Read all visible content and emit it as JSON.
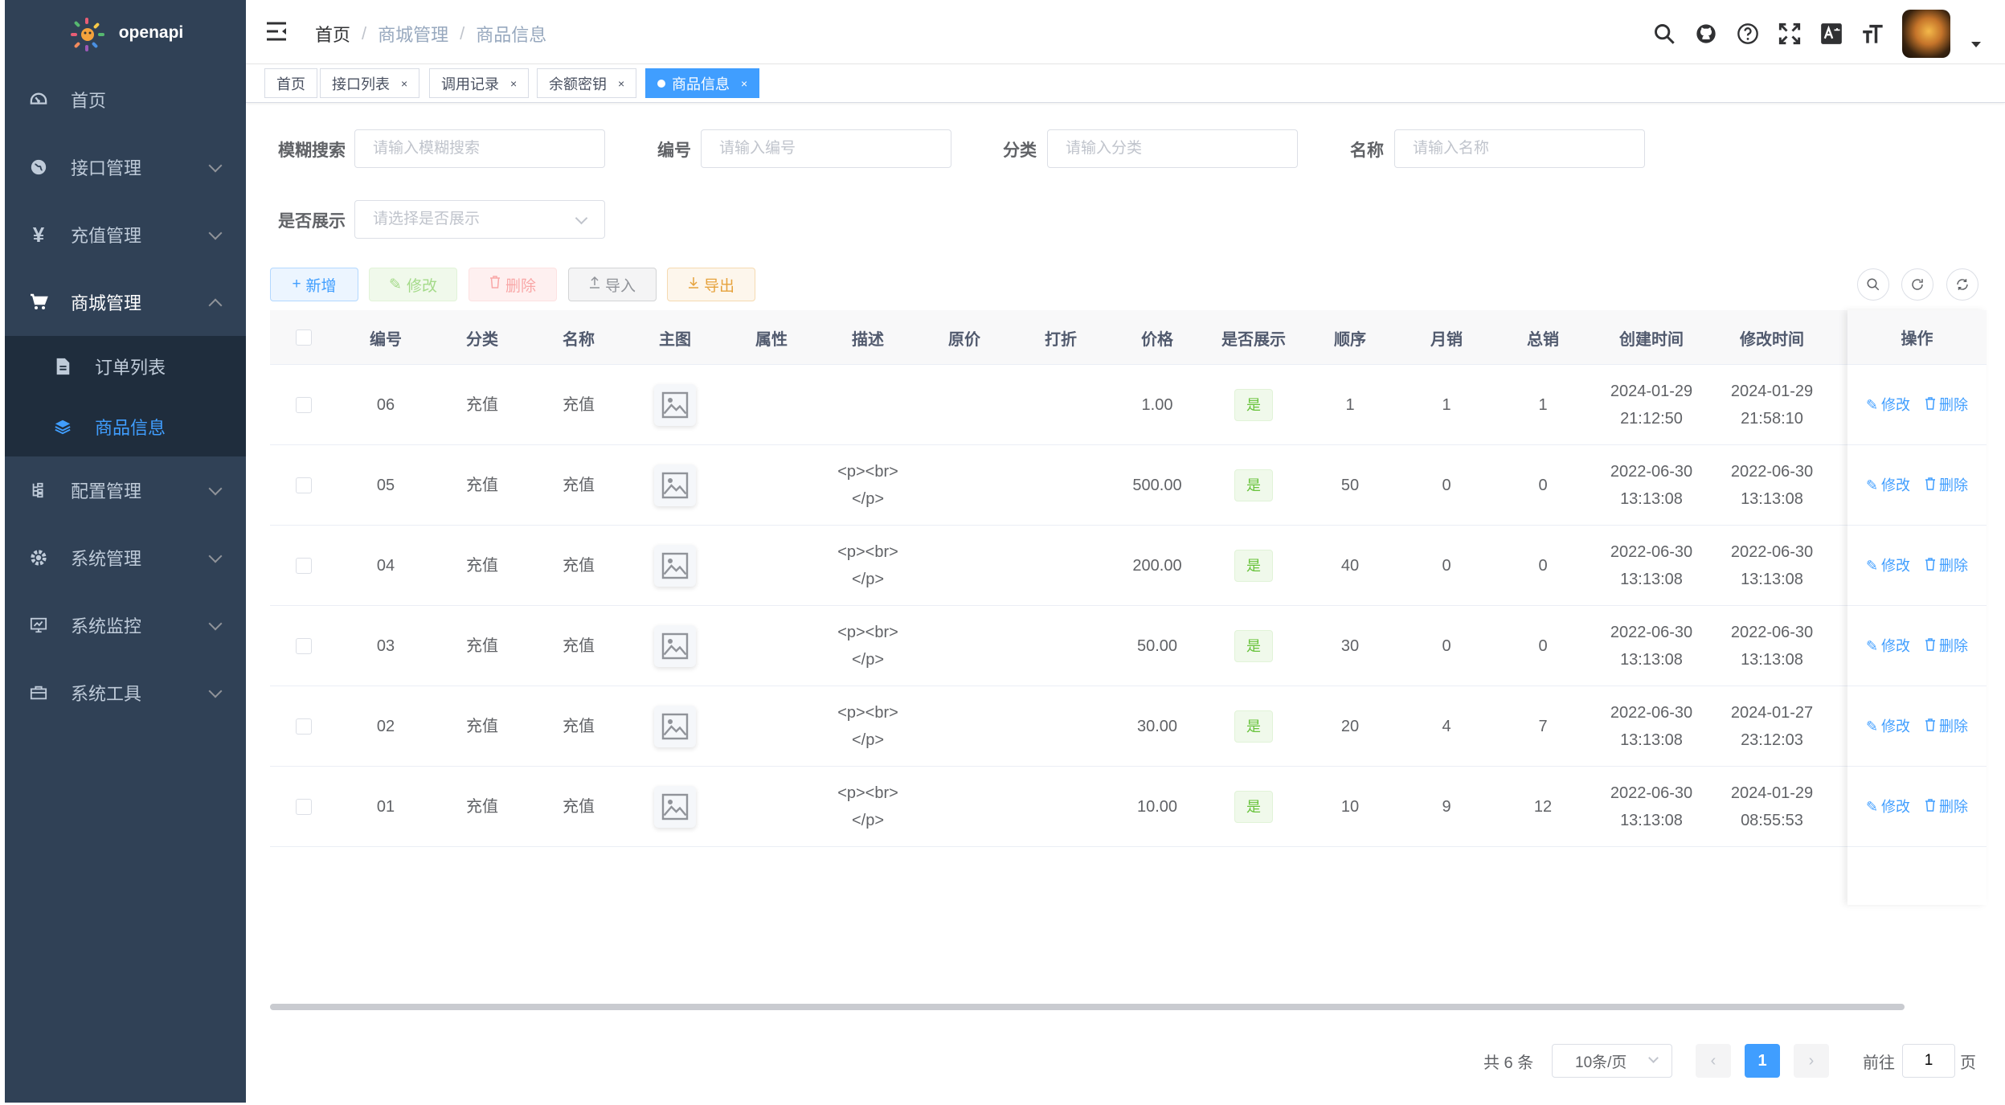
{
  "app": {
    "name": "openapi"
  },
  "sidebar": {
    "items": [
      {
        "label": "首页",
        "icon": "dashboard-icon"
      },
      {
        "label": "接口管理",
        "icon": "globe-icon"
      },
      {
        "label": "充值管理",
        "icon": "yen-icon"
      },
      {
        "label": "商城管理",
        "icon": "cart-icon"
      },
      {
        "label": "配置管理",
        "icon": "tree-icon"
      },
      {
        "label": "系统管理",
        "icon": "gear-icon"
      },
      {
        "label": "系统监控",
        "icon": "monitor-icon"
      },
      {
        "label": "系统工具",
        "icon": "toolbox-icon"
      }
    ],
    "submenu": [
      {
        "label": "订单列表",
        "icon": "document-icon"
      },
      {
        "label": "商品信息",
        "icon": "layers-icon"
      }
    ]
  },
  "header": {
    "breadcrumb": [
      "首页",
      "商城管理",
      "商品信息"
    ],
    "icons": [
      "search-icon",
      "github-icon",
      "help-icon",
      "fullscreen-icon",
      "translate-icon",
      "font-size-icon"
    ]
  },
  "tags": [
    {
      "label": "首页"
    },
    {
      "label": "接口列表"
    },
    {
      "label": "调用记录"
    },
    {
      "label": "余额密钥"
    },
    {
      "label": "商品信息"
    }
  ],
  "search": {
    "fuzzy_label": "模糊搜索",
    "fuzzy_placeholder": "请输入模糊搜索",
    "code_label": "编号",
    "code_placeholder": "请输入编号",
    "category_label": "分类",
    "category_placeholder": "请输入分类",
    "name_label": "名称",
    "name_placeholder": "请输入名称",
    "show_label": "是否展示",
    "show_placeholder": "请选择是否展示"
  },
  "toolbar": {
    "add": "新增",
    "edit": "修改",
    "delete": "删除",
    "import": "导入",
    "export": "导出"
  },
  "table": {
    "columns": [
      "编号",
      "分类",
      "名称",
      "主图",
      "属性",
      "描述",
      "原价",
      "打折",
      "价格",
      "是否展示",
      "顺序",
      "月销",
      "总销",
      "创建时间",
      "修改时间",
      "操作"
    ],
    "rows": [
      {
        "code": "06",
        "category": "充值",
        "name": "充值",
        "attr": "",
        "desc1": "",
        "desc2": "",
        "orig": "",
        "discount": "",
        "price": "1.00",
        "show": "是",
        "order": "1",
        "monthly": "1",
        "total": "1",
        "created_date": "2024-01-29",
        "created_time": "21:12:50",
        "modified_date": "2024-01-29",
        "modified_time": "21:58:10",
        "edit": "修改",
        "delete": "删除"
      },
      {
        "code": "05",
        "category": "充值",
        "name": "充值",
        "attr": "",
        "desc1": "<p><br>",
        "desc2": "</p>",
        "orig": "",
        "discount": "",
        "price": "500.00",
        "show": "是",
        "order": "50",
        "monthly": "0",
        "total": "0",
        "created_date": "2022-06-30",
        "created_time": "13:13:08",
        "modified_date": "2022-06-30",
        "modified_time": "13:13:08",
        "edit": "修改",
        "delete": "删除"
      },
      {
        "code": "04",
        "category": "充值",
        "name": "充值",
        "attr": "",
        "desc1": "<p><br>",
        "desc2": "</p>",
        "orig": "",
        "discount": "",
        "price": "200.00",
        "show": "是",
        "order": "40",
        "monthly": "0",
        "total": "0",
        "created_date": "2022-06-30",
        "created_time": "13:13:08",
        "modified_date": "2022-06-30",
        "modified_time": "13:13:08",
        "edit": "修改",
        "delete": "删除"
      },
      {
        "code": "03",
        "category": "充值",
        "name": "充值",
        "attr": "",
        "desc1": "<p><br>",
        "desc2": "</p>",
        "orig": "",
        "discount": "",
        "price": "50.00",
        "show": "是",
        "order": "30",
        "monthly": "0",
        "total": "0",
        "created_date": "2022-06-30",
        "created_time": "13:13:08",
        "modified_date": "2022-06-30",
        "modified_time": "13:13:08",
        "edit": "修改",
        "delete": "删除"
      },
      {
        "code": "02",
        "category": "充值",
        "name": "充值",
        "attr": "",
        "desc1": "<p><br>",
        "desc2": "</p>",
        "orig": "",
        "discount": "",
        "price": "30.00",
        "show": "是",
        "order": "20",
        "monthly": "4",
        "total": "7",
        "created_date": "2022-06-30",
        "created_time": "13:13:08",
        "modified_date": "2024-01-27",
        "modified_time": "23:12:03",
        "edit": "修改",
        "delete": "删除"
      },
      {
        "code": "01",
        "category": "充值",
        "name": "充值",
        "attr": "",
        "desc1": "<p><br>",
        "desc2": "</p>",
        "orig": "",
        "discount": "",
        "price": "10.00",
        "show": "是",
        "order": "10",
        "monthly": "9",
        "total": "12",
        "created_date": "2022-06-30",
        "created_time": "13:13:08",
        "modified_date": "2024-01-29",
        "modified_time": "08:55:53",
        "edit": "修改",
        "delete": "删除"
      }
    ]
  },
  "pagination": {
    "total": "共 6 条",
    "page_size": "10条/页",
    "current": "1",
    "goto_prefix": "前往",
    "goto_value": "1",
    "goto_suffix": "页"
  },
  "colors": {
    "sidebar_bg": "#304156",
    "primary": "#409eff",
    "success": "#67c23a"
  }
}
